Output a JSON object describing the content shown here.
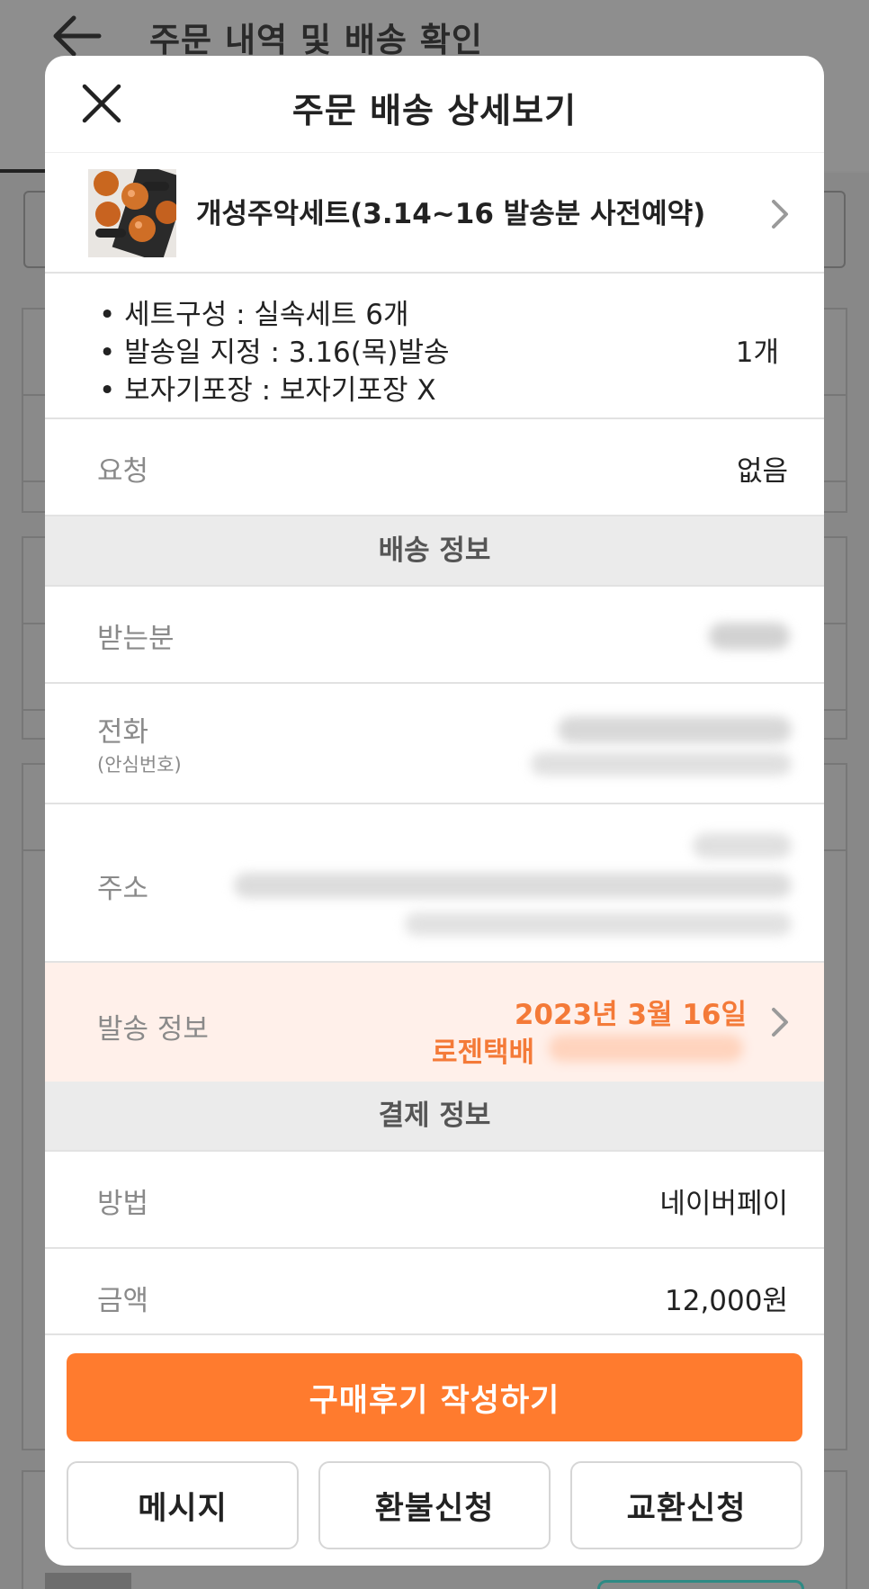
{
  "background_page": {
    "title": "주문 내역 및 배송 확인"
  },
  "modal": {
    "title": "주문 배송 상세보기",
    "product": {
      "name": "개성주악세트(3.14~16 발송분 사전예약)",
      "thumbnail": "fruit-gift-box-thumbnail"
    },
    "options": [
      "• 세트구성 : 실속세트 6개",
      "• 발송일 지정 : 3.16(목)발송",
      "• 보자기포장 : 보자기포장  X"
    ],
    "quantity": "1개",
    "request": {
      "label": "요청",
      "value": "없음"
    },
    "delivery_section": {
      "header": "배송 정보",
      "recipient_label": "받는분",
      "phone_label": "전화",
      "phone_sublabel": "(안심번호)",
      "address_label": "주소"
    },
    "shipping": {
      "label": "발송 정보",
      "date": "2023년 3월 16일",
      "carrier": "로젠택배"
    },
    "payment_section": {
      "header": "결제 정보",
      "method_label": "방법",
      "method_value": "네이버페이",
      "amount_label": "금액",
      "amount_value": "12,000원"
    },
    "buttons": {
      "review": "구매후기 작성하기",
      "message": "메시지",
      "refund": "환불신청",
      "exchange": "교환신청"
    }
  },
  "colors": {
    "accent": "#ff7b2e",
    "shipping_text": "#f47a38",
    "shipping_bg": "#fff0ea",
    "section_bg": "#ebebeb"
  }
}
